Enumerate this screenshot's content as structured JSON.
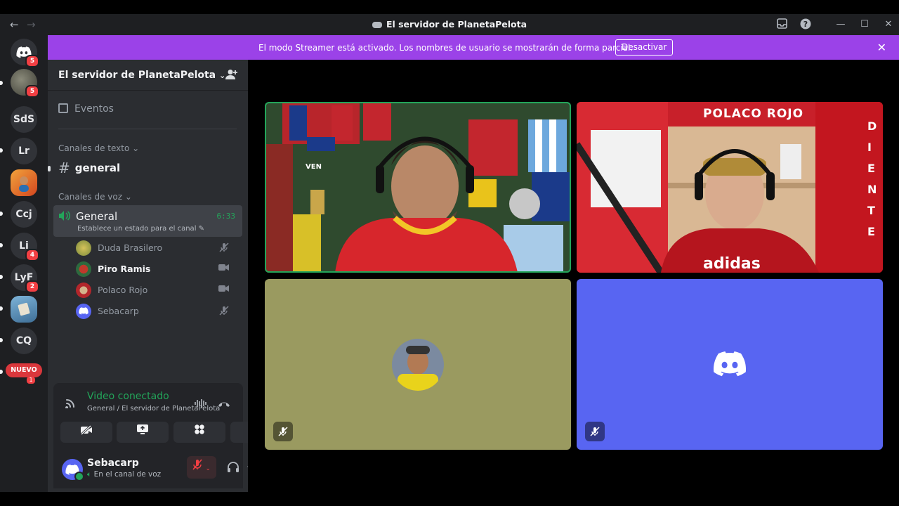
{
  "window": {
    "title": "El servidor de PlanetaPelota",
    "back_icon": "←",
    "forward_icon": "→"
  },
  "rail": {
    "servers": [
      {
        "label": "",
        "badge": "5",
        "icon": "discord-home-icon"
      },
      {
        "label": "",
        "badge": "5",
        "icon": "server-avatar"
      },
      {
        "label": "SdS",
        "badge": ""
      },
      {
        "label": "Lr",
        "badge": ""
      },
      {
        "label": "",
        "badge": "",
        "icon": "server-avatar"
      },
      {
        "label": "Ccj",
        "badge": ""
      },
      {
        "label": "Li",
        "badge": "4"
      },
      {
        "label": "LyF",
        "badge": "2"
      },
      {
        "label": "",
        "badge": "",
        "icon": "server-avatar"
      },
      {
        "label": "CQ",
        "badge": ""
      }
    ],
    "nuevo": "NUEVO",
    "nuevo_badge": "1"
  },
  "banner": {
    "message": "El modo Streamer está activado. Los nombres de usuario se mostrarán de forma parcial.",
    "button": "Desactivar"
  },
  "sidebar": {
    "server_name": "El servidor de PlanetaPelota",
    "events": "Eventos",
    "text_category": "Canales de texto",
    "text_channel": "general",
    "voice_category": "Canales de voz",
    "voice_channel": {
      "name": "General",
      "timer": "6:33",
      "status": "Establece un estado para el canal"
    },
    "members": [
      {
        "name": "Duda Brasilero",
        "active": false,
        "state": "muted"
      },
      {
        "name": "Piro Ramis",
        "active": true,
        "state": "video"
      },
      {
        "name": "Polaco Rojo",
        "active": false,
        "state": "video"
      },
      {
        "name": "Sebacarp",
        "active": false,
        "state": "muted"
      }
    ]
  },
  "voice_panel": {
    "title": "Video conectado",
    "subtitle": "General / El servidor de PlanetaPelota",
    "user_name": "Sebacarp",
    "user_status": "En el canal de voz"
  },
  "stage": {
    "tile2_overlay_text": "POLACO ROJO"
  },
  "colors": {
    "banner": "#9b42e8",
    "accent_green": "#23a55a",
    "blurple": "#5865f2",
    "olive_tile": "#9a9a60"
  }
}
